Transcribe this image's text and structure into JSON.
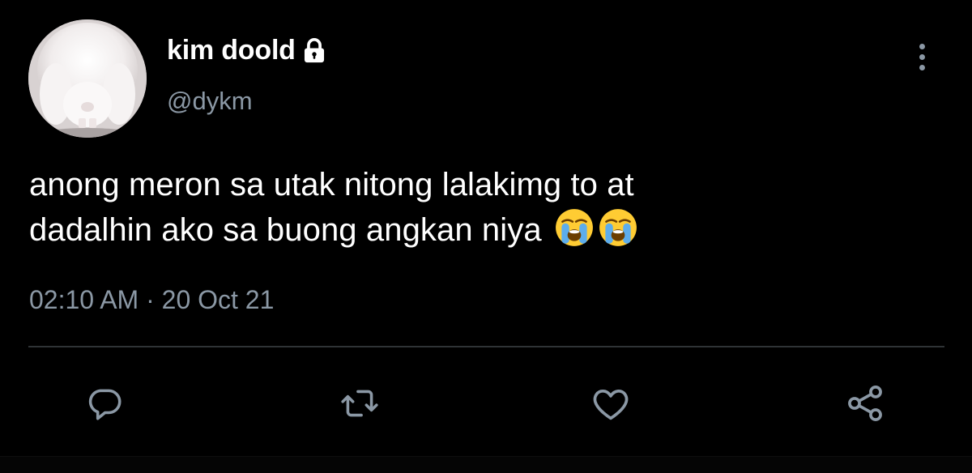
{
  "author": {
    "display_name": "kim doold",
    "handle": "@dykm",
    "avatar_icon": "bunny-avatar",
    "protected_icon": "lock-icon"
  },
  "tweet": {
    "text_line1": "anong meron sa utak nitong lalakimg to at",
    "text_line2": "dadalhin ako sa buong angkan niya",
    "emojis": [
      "😭",
      "😭"
    ],
    "timestamp": "02:10 AM · 20 Oct 21"
  },
  "actions": {
    "reply_icon": "reply-icon",
    "retweet_icon": "retweet-icon",
    "like_icon": "heart-icon",
    "share_icon": "share-icon",
    "more_icon": "more-vertical-icon"
  },
  "colors": {
    "background": "#000000",
    "text": "#ffffff",
    "secondary_text": "#8b98a5",
    "divider": "#2f3336"
  }
}
